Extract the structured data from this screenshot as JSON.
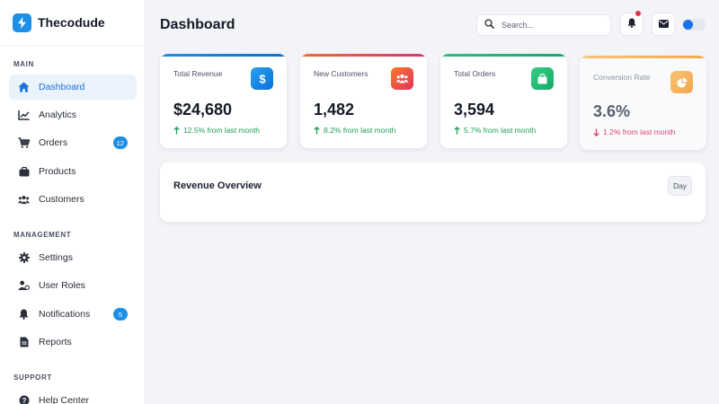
{
  "brand": {
    "name": "Thecodude"
  },
  "sidebar": {
    "sections": [
      {
        "label": "MAIN"
      },
      {
        "label": "MANAGEMENT"
      },
      {
        "label": "SUPPORT"
      }
    ],
    "items": [
      {
        "label": "Dashboard",
        "icon": "home-icon",
        "active": true
      },
      {
        "label": "Analytics",
        "icon": "chart-line-icon"
      },
      {
        "label": "Orders",
        "icon": "cart-icon",
        "badge": "12"
      },
      {
        "label": "Products",
        "icon": "box-icon"
      },
      {
        "label": "Customers",
        "icon": "users-icon"
      },
      {
        "label": "Settings",
        "icon": "gear-icon"
      },
      {
        "label": "User Roles",
        "icon": "user-role-icon"
      },
      {
        "label": "Notifications",
        "icon": "bell-icon",
        "badge": "5"
      },
      {
        "label": "Reports",
        "icon": "document-icon"
      },
      {
        "label": "Help Center",
        "icon": "help-icon"
      }
    ]
  },
  "header": {
    "title": "Dashboard",
    "search_placeholder": "Search..."
  },
  "stats": [
    {
      "label": "Total Revenue",
      "value": "$24,680",
      "change": "12.5% from last month",
      "trend": "up",
      "icon": "dollar-icon",
      "accent": "#1d8fe6"
    },
    {
      "label": "New Customers",
      "value": "1,482",
      "change": "8.2% from last month",
      "trend": "up",
      "icon": "users-icon",
      "accent": "#f0483e"
    },
    {
      "label": "Total Orders",
      "value": "3,594",
      "change": "5.7% from last month",
      "trend": "up",
      "icon": "shopping-bag-icon",
      "accent": "#24c07a"
    },
    {
      "label": "Conversion Rate",
      "value": "3.6%",
      "change": "1.2% from last month",
      "trend": "down",
      "icon": "pie-chart-icon",
      "accent": "#f7b25a"
    }
  ],
  "revenue": {
    "title": "Revenue Overview",
    "period_button": "Day"
  },
  "colors": {
    "primary": "#1d8fe6",
    "positive": "#1f9d5a",
    "negative": "#e0436f"
  }
}
